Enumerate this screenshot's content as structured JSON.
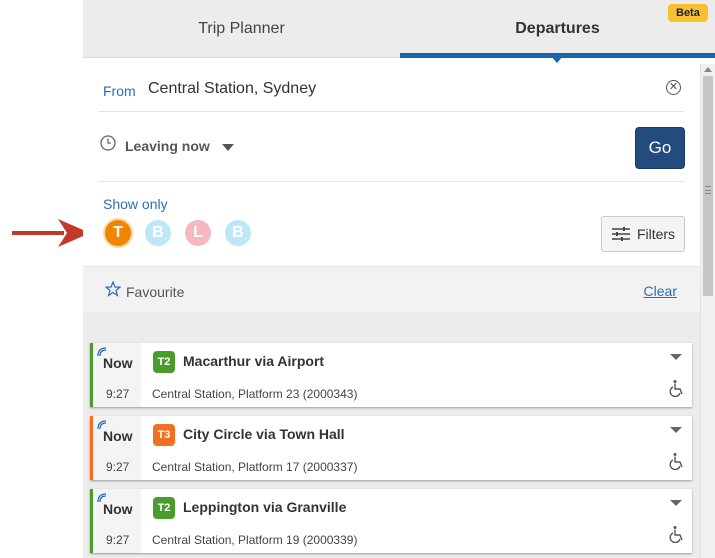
{
  "tabs": {
    "trip_planner": "Trip Planner",
    "departures": "Departures",
    "beta": "Beta"
  },
  "from": {
    "label": "From",
    "value": "Central Station, Sydney"
  },
  "leaving": {
    "label": "Leaving now",
    "go": "Go"
  },
  "show_only": {
    "label": "Show only",
    "modes": [
      {
        "letter": "T",
        "name": "train",
        "color": "#f18500",
        "selected": true
      },
      {
        "letter": "B",
        "name": "bus",
        "color": "#bde6f8",
        "selected": false
      },
      {
        "letter": "L",
        "name": "light-rail",
        "color": "#f7b7bf",
        "selected": false
      },
      {
        "letter": "B",
        "name": "bus",
        "color": "#bde6f8",
        "selected": false
      }
    ],
    "filters": "Filters"
  },
  "favourite": {
    "label": "Favourite",
    "clear": "Clear"
  },
  "departures": [
    {
      "status": "Now",
      "time": "9:27",
      "line": "T2",
      "destination": "Macarthur via Airport",
      "stop": "Central Station, Platform 23 (2000343)",
      "color": "#4a9c2d"
    },
    {
      "status": "Now",
      "time": "9:27",
      "line": "T3",
      "destination": "City Circle via Town Hall",
      "stop": "Central Station, Platform 17 (2000337)",
      "color": "#f37021"
    },
    {
      "status": "Now",
      "time": "9:27",
      "line": "T2",
      "destination": "Leppington via Granville",
      "stop": "Central Station, Platform 19 (2000339)",
      "color": "#4a9c2d"
    }
  ],
  "colors": {
    "accent": "#1466b0",
    "go_button": "#234b7d",
    "arrow": "#c0392b"
  }
}
